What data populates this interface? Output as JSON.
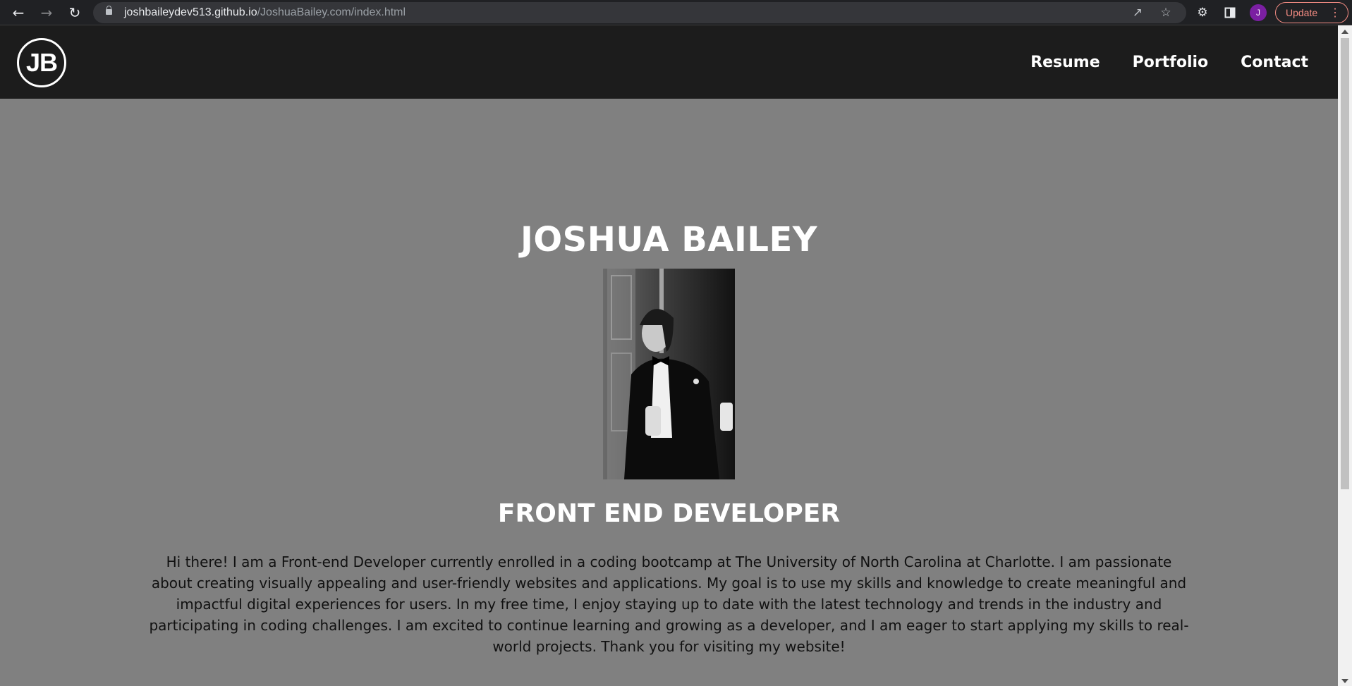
{
  "browser": {
    "url_host": "joshbaileydev513.github.io",
    "url_path": "/JoshuaBailey.com/index.html",
    "profile_initial": "J",
    "update_label": "Update"
  },
  "site": {
    "logo_text": "JB",
    "nav": [
      {
        "label": "Resume"
      },
      {
        "label": "Portfolio"
      },
      {
        "label": "Contact"
      }
    ]
  },
  "hero": {
    "name": "JOSHUA BAILEY",
    "role": "FRONT END DEVELOPER",
    "bio": "Hi there! I am a Front-end Developer currently enrolled in a coding bootcamp at The University of North Carolina at Charlotte. I am passionate about creating visually appealing and user-friendly websites and applications. My goal is to use my skills and knowledge to create meaningful and impactful digital experiences for users. In my free time, I enjoy staying up to date with the latest technology and trends in the industry and participating in coding challenges. I am excited to continue learning and growing as a developer, and I am eager to start applying my skills to real-world projects. Thank you for visiting my website!"
  },
  "colors": {
    "page_bg": "#808080",
    "header_bg": "#1c1c1c",
    "heading": "#ffffff",
    "body_text": "#111111"
  }
}
